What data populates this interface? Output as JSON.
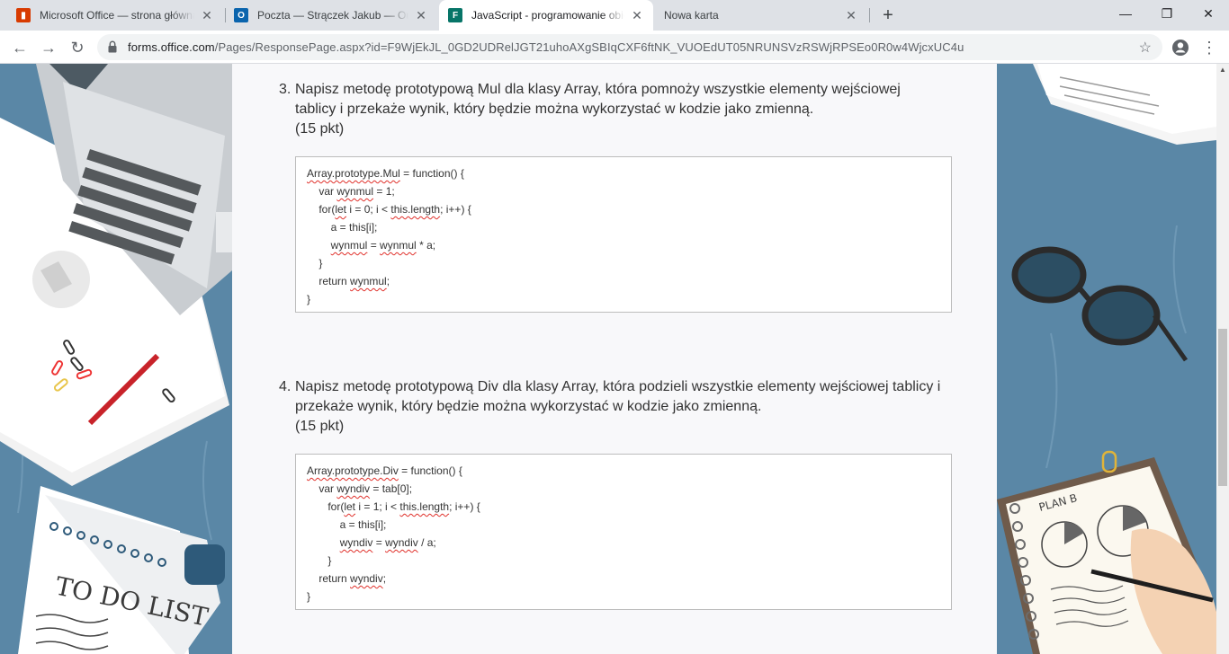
{
  "browser": {
    "tabs": [
      {
        "title": "Microsoft Office — strona główna",
        "icon": "office-icon",
        "color": "#d83b01"
      },
      {
        "title": "Poczta — Strączek Jakub — Outlook",
        "icon": "outlook-icon",
        "color": "#0a64ad"
      },
      {
        "title": "JavaScript - programowanie obiektowe",
        "icon": "forms-icon",
        "color": "#077568",
        "active": true
      },
      {
        "title": "Nowa karta",
        "icon": "",
        "color": ""
      }
    ],
    "url_host": "forms.office.com",
    "url_path": "/Pages/ResponsePage.aspx?id=F9WjEkJL_0GD2UDRelJGT21uhoAXgSBIqCXF6ftNK_VUOEdUT05NRUNSVzRSWjRPSEo0R0w4WjcxUC4u"
  },
  "questions": [
    {
      "number": "3.",
      "text": "Napisz metodę prototypową Mul dla klasy Array, która pomnoży wszystkie elementy wejściowej tablicy i przekaże wynik, który będzie można wykorzystać w kodzie jako zmienną.",
      "points": "(15 pkt)",
      "answer": [
        "Array.prototype.Mul = function() {",
        "    var wynmul = 1;",
        "    for(let i = 0; i < this.length; i++) {",
        "        a = this[i];",
        "        wynmul = wynmul * a;",
        "    }",
        "    return wynmul;",
        "}"
      ]
    },
    {
      "number": "4.",
      "text": "Napisz metodę prototypową Div dla klasy Array, która podzieli wszystkie elementy wejściowej tablicy i przekaże wynik, który będzie można wykorzystać w kodzie jako zmienną.",
      "points": "(15 pkt)",
      "answer": [
        "Array.prototype.Div = function() {",
        "    var wyndiv = tab[0];",
        "       for(let i = 1; i < this.length; i++) {",
        "           a = this[i];",
        "           wyndiv = wyndiv / a;",
        "       }",
        "    return wyndiv;",
        "}"
      ]
    }
  ],
  "decoration": {
    "todo_text": "TO DO LIST",
    "plan_text": "PLAN B"
  }
}
